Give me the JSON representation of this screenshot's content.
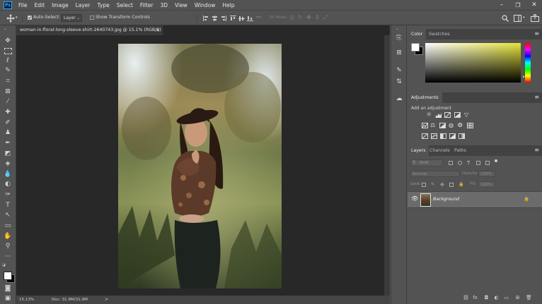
{
  "app": {
    "logo_text": "Ps",
    "menu": [
      "File",
      "Edit",
      "Image",
      "Layer",
      "Type",
      "Select",
      "Filter",
      "3D",
      "View",
      "Window",
      "Help"
    ],
    "window_controls": [
      "–",
      "❐",
      "✕"
    ]
  },
  "options": {
    "auto_select_label": "Auto-Select:",
    "auto_select_checked": true,
    "layer_select_value": "Layer",
    "show_transform_label": "Show Transform Controls",
    "mode_3d_label": "3D Mode:"
  },
  "document": {
    "tab_title": "woman-in-floral-long-sleeve-shirt-2640743.jpg @ 15.1% (RGB/8)",
    "tab_close": "×",
    "zoom": "15.13%",
    "doc_info": "Doc: 31.9M/31.9M",
    "status_arrow": ">"
  },
  "color_panel": {
    "tabs": [
      "Color",
      "Swatches"
    ],
    "hue_color": "#e6e33a",
    "foreground": "#ffffff",
    "background": "#000000"
  },
  "adjustments_panel": {
    "tab": "Adjustments",
    "hint": "Add an adjustment"
  },
  "layers_panel": {
    "tabs": [
      "Layers",
      "Channels",
      "Paths"
    ],
    "filter_placeholder": "Kind",
    "blend_mode": "Normal",
    "opacity_label": "Opacity:",
    "opacity_value": "100%",
    "lock_label": "Lock:",
    "fill_label": "Fill:",
    "fill_value": "100%",
    "layers": [
      {
        "name": "Background",
        "visible": true,
        "locked": true
      }
    ]
  }
}
